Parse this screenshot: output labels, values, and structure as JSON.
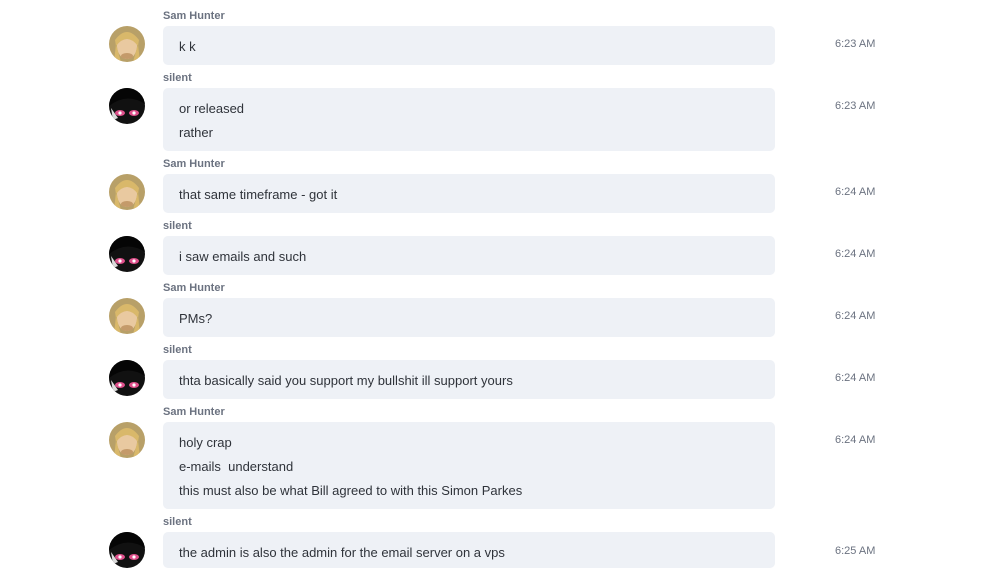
{
  "messages": [
    {
      "author": "Sam Hunter",
      "avatar": "sam-avatar",
      "lines": [
        "k k"
      ],
      "time": "6:23 AM"
    },
    {
      "author": "silent",
      "avatar": "silent-avatar",
      "lines": [
        "or released",
        "rather"
      ],
      "time": "6:23 AM"
    },
    {
      "author": "Sam Hunter",
      "avatar": "sam-avatar",
      "lines": [
        "that same timeframe - got it"
      ],
      "time": "6:24 AM"
    },
    {
      "author": "silent",
      "avatar": "silent-avatar",
      "lines": [
        "i saw emails and such"
      ],
      "time": "6:24 AM"
    },
    {
      "author": "Sam Hunter",
      "avatar": "sam-avatar",
      "lines": [
        "PMs?"
      ],
      "time": "6:24 AM"
    },
    {
      "author": "silent",
      "avatar": "silent-avatar",
      "lines": [
        "thta basically said you support my bullshit ill support yours"
      ],
      "time": "6:24 AM"
    },
    {
      "author": "Sam Hunter",
      "avatar": "sam-avatar",
      "lines": [
        "holy crap",
        "e-mails  understand",
        "this must also be what Bill agreed to with this Simon Parkes"
      ],
      "time": "6:24 AM"
    },
    {
      "author": "silent",
      "avatar": "silent-avatar",
      "lines": [
        "the admin is also the admin for the email server on a vps"
      ],
      "time": "6:25 AM"
    }
  ],
  "colors": {
    "bubble": "#eef1f6",
    "author": "#6b7280",
    "text": "#2f333a",
    "timestamp": "#6b7280"
  }
}
